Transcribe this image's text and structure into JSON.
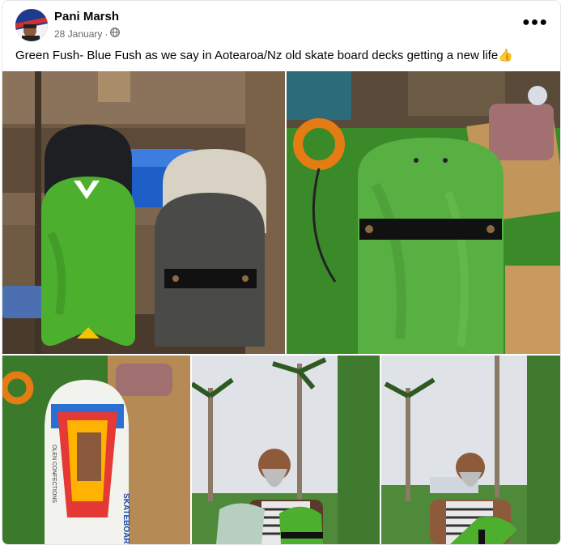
{
  "post": {
    "author": "Pani Marsh",
    "date": "28 January",
    "date_separator": "·",
    "caption": "Green Fush- Blue Fush as we say in Aotearoa/Nz old skate board decks  getting a new life",
    "caption_emoji": "👍"
  },
  "icons": {
    "audience": "globe-icon",
    "more": "more-options-icon"
  },
  "photos": {
    "p3_deck_text_1": "SKATEBOARDS",
    "p3_deck_text_2": "OLEN CONFECTIONS"
  },
  "colors": {
    "text_primary": "#050505",
    "text_secondary": "#65676b",
    "grass_green": "#3a8a2a",
    "deck_green": "#4caf2e"
  }
}
